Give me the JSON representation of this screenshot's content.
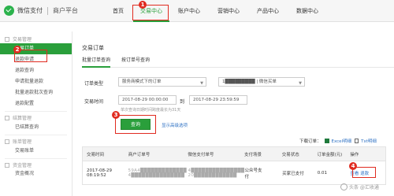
{
  "brand": {
    "name": "微信支付",
    "sub": "商户平台"
  },
  "nav": [
    {
      "label": "首页"
    },
    {
      "label": "交易中心"
    },
    {
      "label": "账户中心"
    },
    {
      "label": "营销中心"
    },
    {
      "label": "产品中心"
    },
    {
      "label": "数据中心"
    }
  ],
  "badges": [
    "1",
    "2",
    "3",
    "4"
  ],
  "sidebar": {
    "group1": "交易管理",
    "items1": [
      "交易订单",
      "退款申请",
      "退款查询",
      "申请批量退款",
      "批量退款批次查询",
      "退款配置"
    ],
    "group2": "结算管理",
    "items2": [
      "已结算查询"
    ],
    "group3": "账单管理",
    "items3": [
      "交易账单"
    ],
    "group4": "资金管理",
    "items4": [
      "资金概况"
    ]
  },
  "main": {
    "title": "交易订单",
    "tabs": [
      "批量订单查询",
      "按订单号查询"
    ],
    "order_type_label": "订单类型",
    "order_type_value": "服务商模式下的订单",
    "merchant_value": "1█████████ | 微信买单",
    "time_label": "交易时间",
    "time_start": "2017-08-29 00:00:00",
    "time_to": "到",
    "time_end": "2017-08-29 23:59:59",
    "hint": "单次查询日期时间跨度最长为31天",
    "query_btn": "查询",
    "advanced": "显示高级选项",
    "download_label": "下载订单：",
    "download_excel": "Excel明细",
    "download_txt": "Txt明细"
  },
  "table": {
    "headers": [
      "交易时间",
      "商户订单号",
      "微信支付单号",
      "支付场景",
      "交易状态",
      "订单金额(元)",
      "操作"
    ],
    "rows": [
      {
        "date": "2017-08-29",
        "time": "08:19:52",
        "order_no_1": "59A4█████████████",
        "order_no_2": "4███████████████",
        "wx_no_1": "4███████████████",
        "wx_no_2": "20████████████",
        "scene_1": "公众号支",
        "scene_2": "付",
        "status": "买家已支付",
        "amount": "0.01",
        "ops": "查看 退款"
      }
    ]
  },
  "watermark": "头条 @汇收通"
}
